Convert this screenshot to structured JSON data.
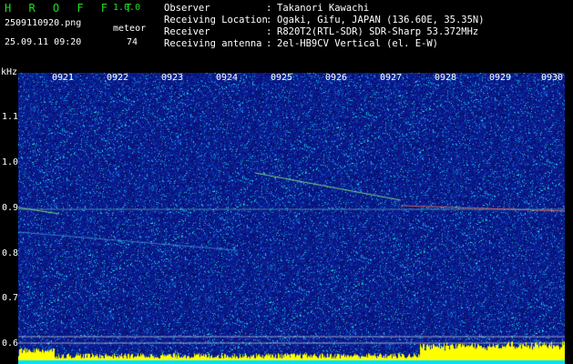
{
  "app": {
    "title": "H R O F F T",
    "version": "1.0.0",
    "filename": "2509110920.png",
    "datetime": "25.09.11 09:20",
    "meteor_label": "meteor",
    "meteor_count": "74"
  },
  "info": {
    "rows": [
      {
        "key": "Observer",
        "sep": ":",
        "value": "Takanori Kawachi"
      },
      {
        "key": "Receiving Location",
        "sep": ":",
        "value": "Ogaki, Gifu, JAPAN (136.60E, 35.35N)"
      },
      {
        "key": "Receiver",
        "sep": ":",
        "value": "R820T2(RTL-SDR) SDR-Sharp 53.372MHz"
      },
      {
        "key": "Receiving antenna",
        "sep": ":",
        "value": "2el-HB9CV Vertical (el. E-W)"
      }
    ]
  },
  "axis": {
    "unit": "kHz",
    "y_ticks": [
      "1.1",
      "1.0",
      "0.9",
      "0.8",
      "0.7",
      "0.6"
    ],
    "x_ticks": [
      "0921",
      "0922",
      "0923",
      "0924",
      "0925",
      "0926",
      "0927",
      "0928",
      "0929",
      "0930"
    ]
  },
  "colors": {
    "background": "#000000",
    "waterfall_base": "#0a1a8c",
    "title_green": "#22dd22",
    "echo_yellow": "#ffff00"
  }
}
